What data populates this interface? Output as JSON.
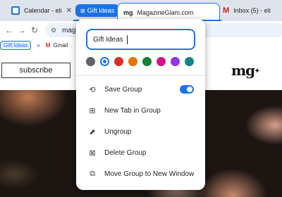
{
  "tabs": [
    {
      "title": "Calendar - eli",
      "icon": "calendar-icon"
    },
    {
      "title": "MagazineGlam.com",
      "icon": "mg-logo-icon",
      "active": true
    },
    {
      "title": "Inbox (5) - eli",
      "icon": "gmail-icon"
    }
  ],
  "tab_group": {
    "name": "Gift Ideas",
    "color": "#1a73e8"
  },
  "toolbar": {
    "address_partial": "mag"
  },
  "bookmarks": {
    "group_label": "Gift Ideas",
    "chevron": "»",
    "gmail_label": "Gmail"
  },
  "page": {
    "subscribe_label": "subscribe",
    "logo_text": "mg"
  },
  "popup": {
    "group_name_value": "Gift Ideas",
    "colors": [
      {
        "name": "grey",
        "hex": "#5f6368"
      },
      {
        "name": "blue",
        "hex": "#1a73e8",
        "selected": true
      },
      {
        "name": "red",
        "hex": "#d93025"
      },
      {
        "name": "orange",
        "hex": "#e8710a"
      },
      {
        "name": "green",
        "hex": "#188038"
      },
      {
        "name": "pink",
        "hex": "#d01884"
      },
      {
        "name": "purple",
        "hex": "#9334e6"
      },
      {
        "name": "cyan",
        "hex": "#12858a"
      }
    ],
    "menu": [
      {
        "label": "Save Group",
        "icon": "save-group-icon",
        "toggle": true
      },
      {
        "label": "New Tab in Group",
        "icon": "new-tab-icon"
      },
      {
        "label": "Ungroup",
        "icon": "ungroup-icon"
      },
      {
        "label": "Delete Group",
        "icon": "delete-group-icon"
      },
      {
        "label": "Move Group to New Window",
        "icon": "move-window-icon"
      }
    ]
  }
}
